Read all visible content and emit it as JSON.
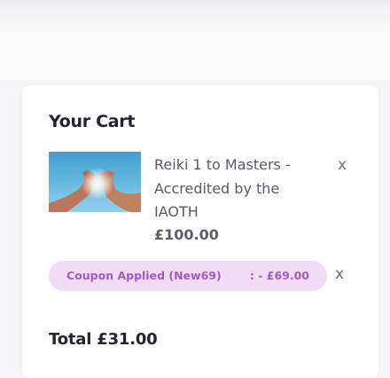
{
  "cart": {
    "title": "Your Cart",
    "items": [
      {
        "name": "Reiki 1 to Masters - Accredited by the IAOTH",
        "price": "£100.00",
        "remove_label": "x",
        "image_icon": "hands-light-photo"
      }
    ],
    "coupon": {
      "label": "Coupon Applied (New69)",
      "amount": ": - £69.00",
      "remove_label": "x"
    },
    "total": "Total £31.00"
  },
  "colors": {
    "coupon_bg": "#f1dcf5",
    "coupon_text": "#a45bc0",
    "heading": "#22252e"
  }
}
